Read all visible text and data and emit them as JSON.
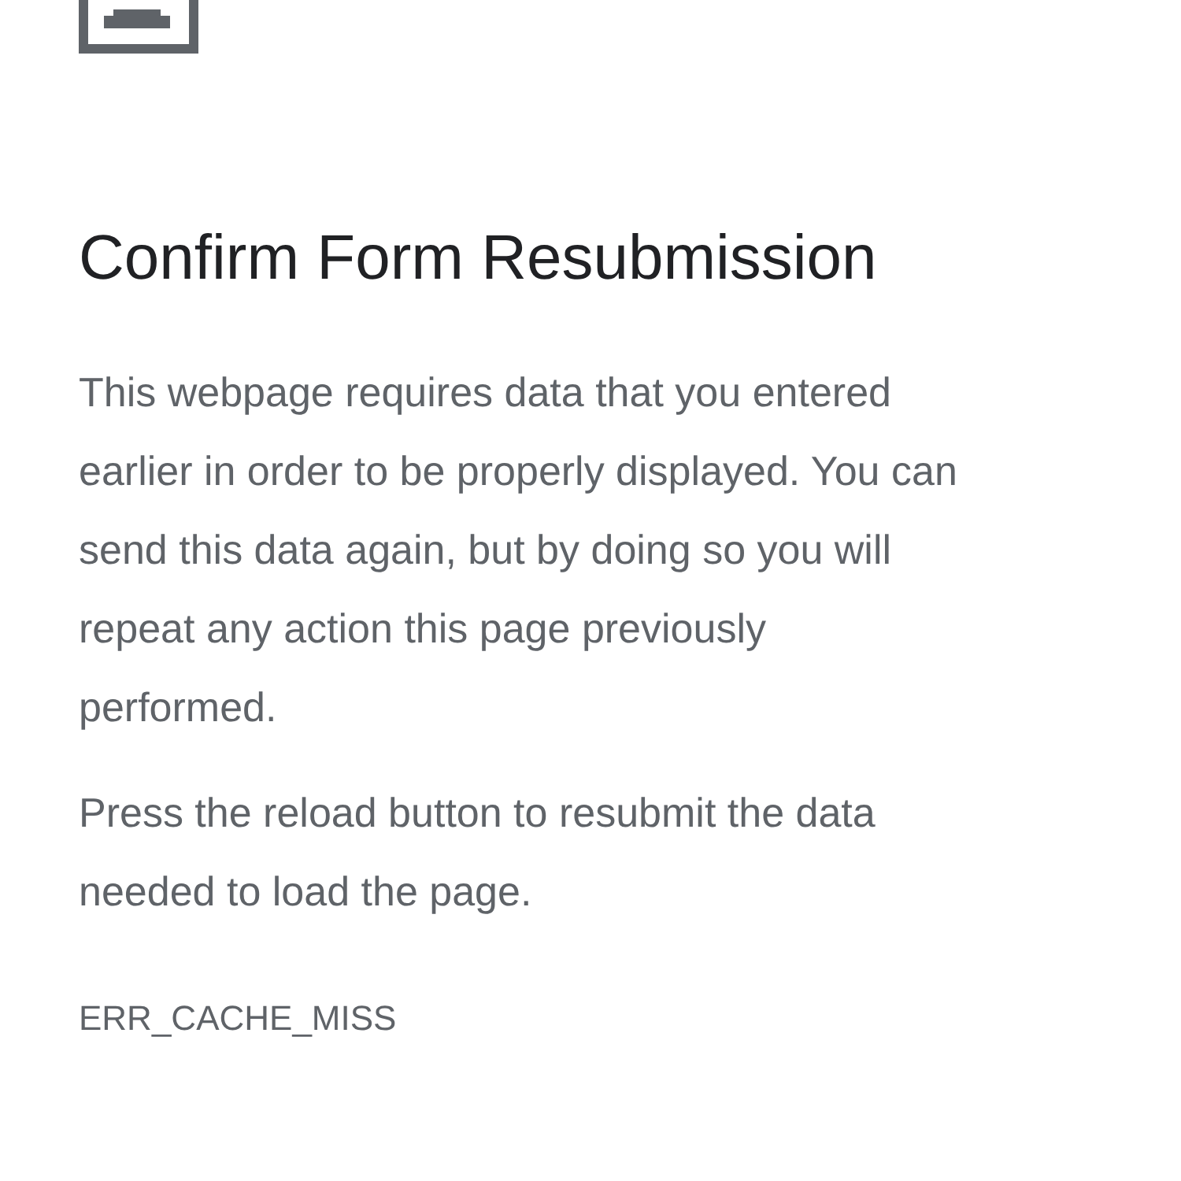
{
  "title": "Confirm Form Resubmission",
  "paragraphs": [
    [
      "This webpage requires data that you entered",
      "earlier in order to be properly displayed. You can",
      "send this data again, but by doing so you will",
      "repeat any action this page previously",
      "performed."
    ],
    [
      "Press the reload button to resubmit the data",
      "needed to load the page."
    ]
  ],
  "error_code": "ERR_CACHE_MISS"
}
